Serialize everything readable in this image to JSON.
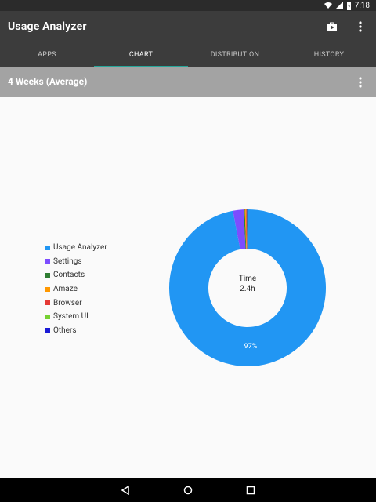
{
  "status_bar": {
    "time": "7:18"
  },
  "app_bar": {
    "title": "Usage Analyzer"
  },
  "tabs": [
    {
      "label": "APPS"
    },
    {
      "label": "CHART"
    },
    {
      "label": "DISTRIBUTION"
    },
    {
      "label": "HISTORY"
    }
  ],
  "period": {
    "label": "4 Weeks (Average)"
  },
  "legend": [
    {
      "label": "Usage Analyzer",
      "color": "#2196f3"
    },
    {
      "label": "Settings",
      "color": "#7c4dff"
    },
    {
      "label": "Contacts",
      "color": "#2e7d32"
    },
    {
      "label": "Amaze",
      "color": "#ff9800"
    },
    {
      "label": "Browser",
      "color": "#e53935"
    },
    {
      "label": "System UI",
      "color": "#76d132"
    },
    {
      "label": "Others",
      "color": "#1a1ad6"
    }
  ],
  "chart_center": {
    "line1": "Time",
    "line2": "2.4h"
  },
  "chart_label": {
    "text": "97%"
  },
  "colors": {
    "accent": "#26a69a",
    "app_bar": "#3c3c3c",
    "period_bar": "#a3a3a3"
  },
  "chart_data": {
    "type": "pie",
    "categories": [
      "Usage Analyzer",
      "Settings",
      "Contacts",
      "Amaze",
      "Browser",
      "System UI",
      "Others"
    ],
    "values": [
      97,
      2.2,
      0.25,
      0.2,
      0.15,
      0.1,
      0.1
    ],
    "center_label": [
      "Time",
      "2.4h"
    ],
    "labels_shown": [
      "97%"
    ]
  }
}
